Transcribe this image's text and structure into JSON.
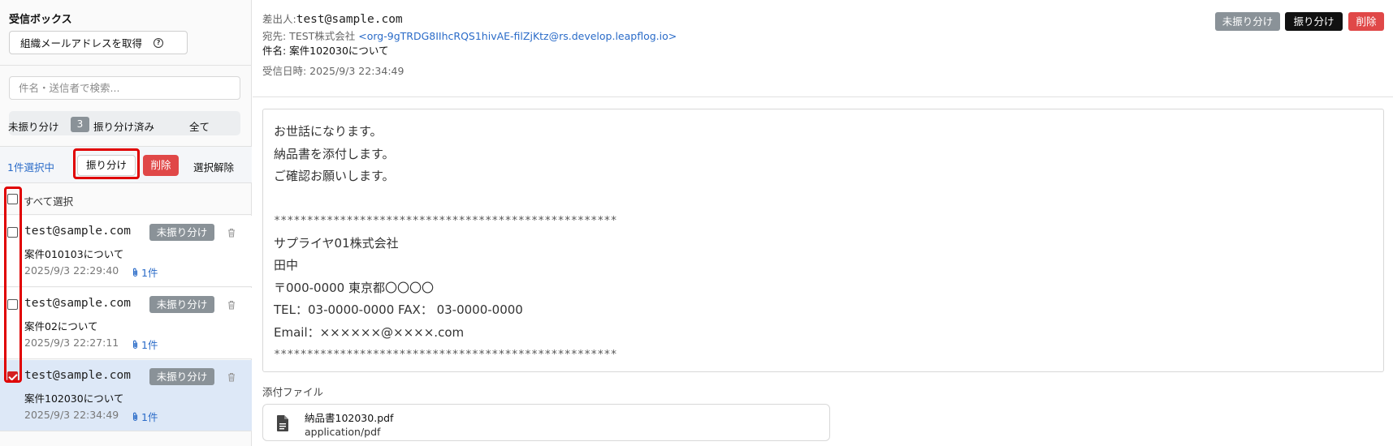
{
  "sidebar": {
    "title": "受信ボックス",
    "org_button_label": "組織メールアドレスを取得",
    "help_icon": "?",
    "search_placeholder": "件名・送信者で検索...",
    "filter_tabs": [
      {
        "label": "未振り分け",
        "count": "3"
      },
      {
        "label": "振り分け済み"
      },
      {
        "label": "全て"
      }
    ],
    "selection": {
      "count_text": "1件選択中",
      "assign_label": "振り分け",
      "delete_label": "削除",
      "clear_label": "選択解除"
    },
    "select_all_label": "すべて選択",
    "mails": [
      {
        "from": "test@sample.com",
        "badge": "未振り分け",
        "subject": "案件010103について",
        "date": "2025/9/3 22:29:40",
        "attachments": "1件",
        "checked": false
      },
      {
        "from": "test@sample.com",
        "badge": "未振り分け",
        "subject": "案件02について",
        "date": "2025/9/3 22:27:11",
        "attachments": "1件",
        "checked": false
      },
      {
        "from": "test@sample.com",
        "badge": "未振り分け",
        "subject": "案件102030について",
        "date": "2025/9/3 22:34:49",
        "attachments": "1件",
        "checked": true
      }
    ]
  },
  "detail": {
    "from_label": "差出人:",
    "from": "test@sample.com",
    "to_label": "宛先: TEST株式会社 ",
    "to_address": "<org-9gTRDG8IIhcRQS1hivAE-filZjKtz@rs.develop.leapflog.io>",
    "subject_line": "件名: 案件102030について",
    "date_line": "受信日時: 2025/9/3 22:34:49",
    "actions": {
      "unassigned": "未振り分け",
      "assign": "振り分け",
      "delete": "削除"
    },
    "body_lines": [
      "お世話になります。",
      "納品書を添付します。",
      "ご確認お願いします。",
      "",
      "****************************************************",
      "サプライヤ01株式会社",
      "田中",
      "〒000-0000 東京都〇〇〇〇",
      "TEL：03-0000-0000 FAX： 03-0000-0000",
      "Email：××××××@××××.com",
      "****************************************************"
    ],
    "attachments_label": "添付ファイル",
    "attachment": {
      "name": "納品書102030.pdf",
      "type": "application/pdf"
    }
  },
  "colors": {
    "accent_blue": "#2a6bc8",
    "badge_gray": "#8a9298",
    "danger_red": "#e04848",
    "highlight_red": "#e00000",
    "selected_bg": "#dde8f7"
  }
}
